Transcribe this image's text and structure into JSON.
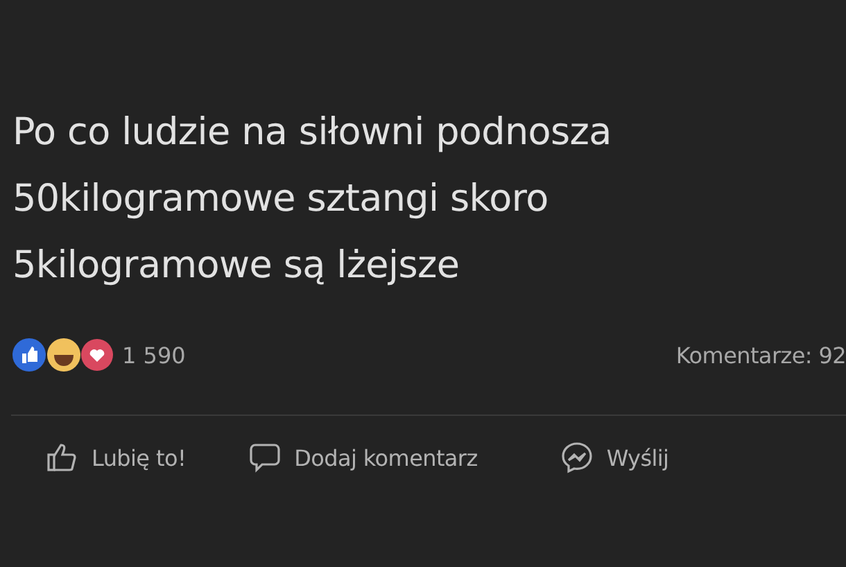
{
  "post": {
    "lines": [
      "Po co ludzie na siłowni podnosza",
      "50kilogramowe sztangi skoro",
      "5kilogramowe są lżejsze"
    ]
  },
  "reactions": {
    "count": "1 590",
    "comments": "Komentarze: 92"
  },
  "actions": [
    {
      "kind": "like",
      "label": "Lubię to!"
    },
    {
      "kind": "comment",
      "label": "Dodaj komentarz"
    },
    {
      "kind": "send",
      "label": "Wyślij"
    }
  ]
}
